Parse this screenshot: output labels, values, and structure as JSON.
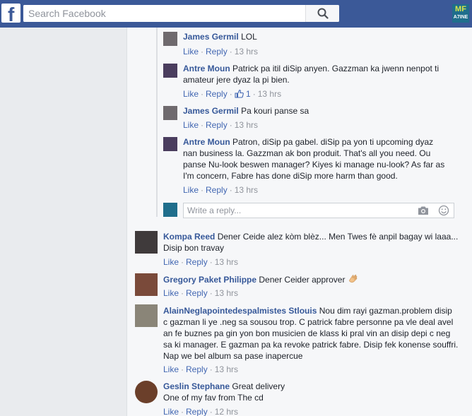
{
  "topbar": {
    "logo_letter": "f",
    "search_placeholder": "Search Facebook",
    "page_logo_top": "MF",
    "page_logo_bottom": "A7INE"
  },
  "labels": {
    "like": "Like",
    "reply": "Reply"
  },
  "replies": [
    {
      "author": "James Germil",
      "text": "LOL",
      "time": "13 hrs"
    },
    {
      "author": "Antre Moun",
      "text_lines": [
        "Patrick pa itil diSip anyen. Gazzman ka jwenn nenpot ti",
        "amateur jere dyaz la pi bien."
      ],
      "likes": "1",
      "time": "13 hrs"
    },
    {
      "author": "James Germil",
      "text": "Pa kouri panse sa",
      "time": "13 hrs"
    },
    {
      "author": "Antre Moun",
      "text_lines": [
        "Patron, diSip pa gabel. diSip pa yon ti upcoming dyaz",
        "nan business la. Gazzman ak bon produit. That's all you need. Ou",
        "panse Nu-look beswen manager? Kiyes ki manage nu-look? As far as",
        "I'm concern, Fabre has done diSip more harm than good."
      ],
      "time": "13 hrs"
    }
  ],
  "write_reply": {
    "placeholder": "Write a reply..."
  },
  "comments": [
    {
      "author": "Kompa Reed",
      "text_lines": [
        "Dener Ceide alez kòm blèz... Men Twes fè anpil bagay wi laaa...",
        "Disip bon travay"
      ],
      "time": "13 hrs"
    },
    {
      "author": "Gregory Paket Philippe",
      "text": "Dener Ceider approver",
      "time": "13 hrs"
    },
    {
      "author": "AlainNeglapointedespalmistes Stlouis",
      "text_lines": [
        "Nou dim rayi gazman.problem disip",
        "c gazman li ye .neg sa sousou trop. C patrick fabre personne pa vle deal avel",
        "an fe buznes pa gin yon bon musicien de klass ki pral vin an disip depi c neg",
        "sa ki manager. E gazman pa ka revoke patrick fabre. Disip fek konense souffri.",
        "Nap we bel album sa pase inapercue"
      ],
      "time": "13 hrs"
    },
    {
      "author": "Geslin Stephane",
      "text_lines": [
        "Great delivery",
        "One of my fav from The cd"
      ],
      "time": "12 hrs"
    }
  ]
}
